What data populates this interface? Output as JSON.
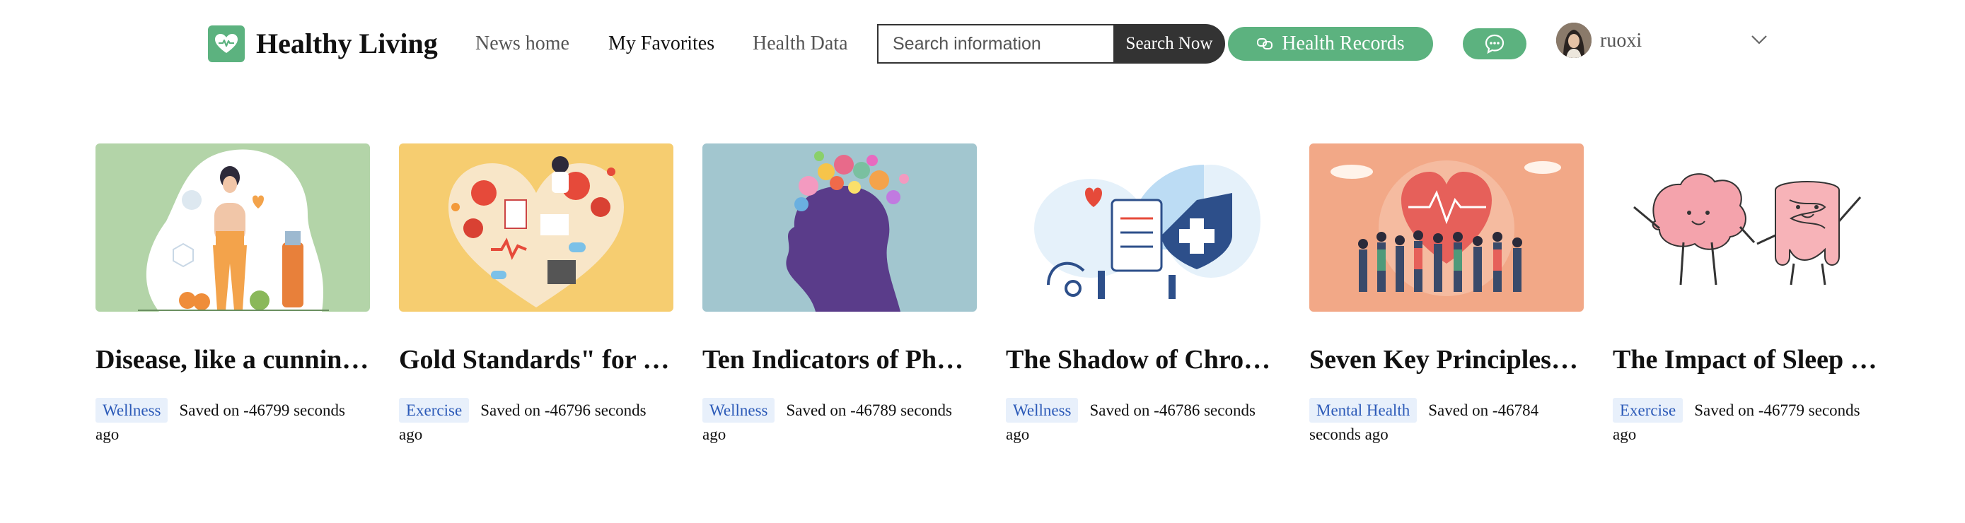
{
  "app": {
    "title": "Healthy Living",
    "brand_color": "#5cb27f"
  },
  "nav": [
    {
      "label": "News home",
      "active": false
    },
    {
      "label": "My Favorites",
      "active": true
    },
    {
      "label": "Health Data",
      "active": false
    }
  ],
  "search": {
    "placeholder": "Search information",
    "button_label": "Search Now"
  },
  "records_button": {
    "label": "Health Records",
    "icon": "records-icon"
  },
  "chat_button": {
    "icon": "chat-icon"
  },
  "user": {
    "name": "ruoxi",
    "menu_icon": "chevron-down-icon"
  },
  "cards": [
    {
      "title": "Disease, like a cunning thief",
      "tag": "Wellness",
      "saved": "Saved on -46799 seconds ago",
      "bg": "#b3d4a8"
    },
    {
      "title": "Gold Standards\" for Health",
      "tag": "Exercise",
      "saved": "Saved on -46796 seconds ago",
      "bg": "#f6cd70"
    },
    {
      "title": "Ten Indicators of Physical Health",
      "tag": "Wellness",
      "saved": "Saved on -46789 seconds ago",
      "bg": "#a2c6cf"
    },
    {
      "title": "The Shadow of Chronic Disease",
      "tag": "Wellness",
      "saved": "Saved on -46786 seconds ago",
      "bg": "#ffffff"
    },
    {
      "title": "Seven Key Principles of Mental Health",
      "tag": "Mental Health",
      "saved": "Saved on -46784 seconds ago",
      "bg": "#f2a887"
    },
    {
      "title": "The Impact of Sleep on the Gut",
      "tag": "Exercise",
      "saved": "Saved on -46779 seconds ago",
      "bg": "#ffffff"
    }
  ]
}
